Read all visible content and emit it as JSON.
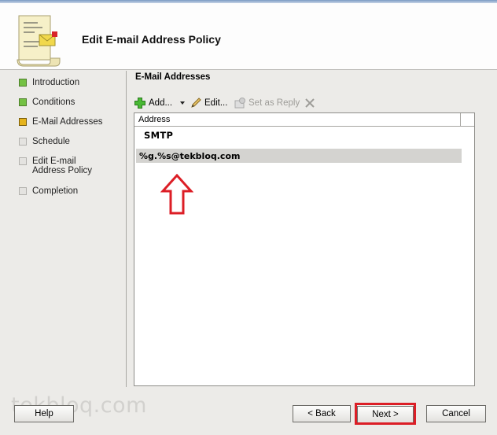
{
  "header": {
    "title": "Edit E-mail Address Policy",
    "icon": "wizard-scroll-icon"
  },
  "nav": {
    "items": [
      {
        "label": "Introduction",
        "state": "done"
      },
      {
        "label": "Conditions",
        "state": "done"
      },
      {
        "label": "E-Mail Addresses",
        "state": "current"
      },
      {
        "label": "Schedule",
        "state": "pending"
      },
      {
        "label": "Edit E-mail Address Policy",
        "state": "pending"
      },
      {
        "label": "Completion",
        "state": "pending"
      }
    ]
  },
  "main": {
    "section_title": "E-Mail Addresses",
    "toolbar": {
      "add_label": "Add...",
      "edit_label": "Edit...",
      "set_as_reply_label": "Set as Reply",
      "remove_icon": "remove-x-icon"
    },
    "list": {
      "column_header": "Address",
      "group_label": "SMTP",
      "rows": [
        "%g.%s@tekbloq.com"
      ]
    }
  },
  "watermark": "tekbloq.com",
  "footer": {
    "help_label": "Help",
    "back_label": "< Back",
    "next_label": "Next >",
    "cancel_label": "Cancel"
  },
  "colors": {
    "highlight": "#dc1e26",
    "done": "#74c143",
    "current": "#e5b31c",
    "pending": "#e4e3e0"
  }
}
